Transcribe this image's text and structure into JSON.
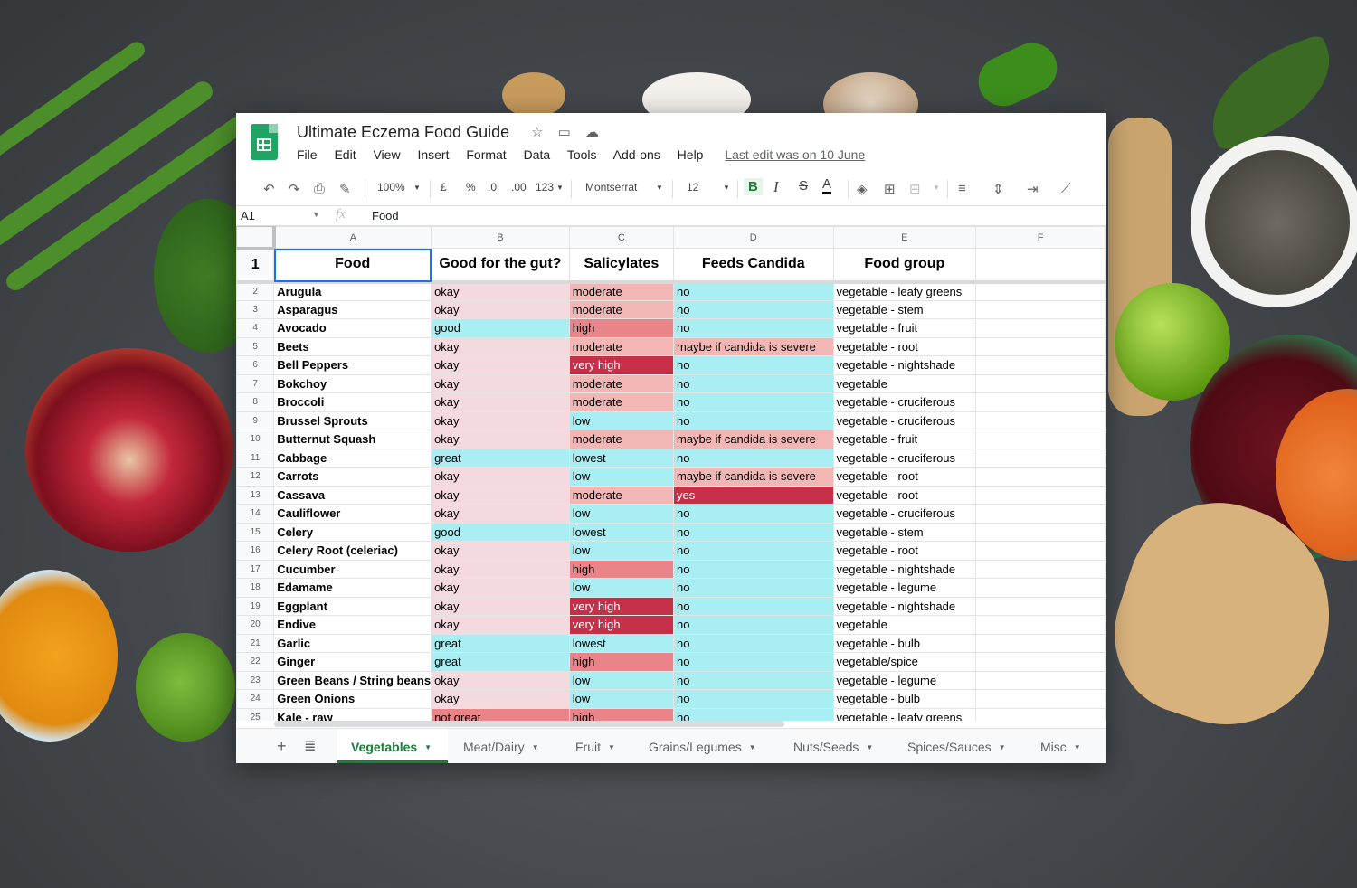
{
  "window": {
    "doc_title": "Ultimate Eczema Food Guide",
    "menu": [
      "File",
      "Edit",
      "View",
      "Insert",
      "Format",
      "Data",
      "Tools",
      "Add-ons",
      "Help"
    ],
    "last_edit": "Last edit was on 10 June"
  },
  "toolbar": {
    "zoom": "100%",
    "currency": "£",
    "percent": "%",
    "dec_less": ".0",
    "dec_more": ".00",
    "more_formats": "123",
    "font": "Montserrat",
    "font_size": "12",
    "bold": "B",
    "italic": "I",
    "strike": "S",
    "text_color": "A"
  },
  "formula_bar": {
    "cell_ref": "A1",
    "fx": "fx",
    "value": "Food"
  },
  "columns": [
    "A",
    "B",
    "C",
    "D",
    "E",
    "F"
  ],
  "header_row": {
    "number": "1",
    "cells": [
      "Food",
      "Good for the gut?",
      "Salicylates",
      "Feeds Candida",
      "Food group",
      ""
    ]
  },
  "colors": {
    "pink": "#f4d9de",
    "cyan": "#a9eef2",
    "moderate": "#f2b7b5",
    "high": "#ea8488",
    "very_high": "#c62f48",
    "yes": "#c62f48",
    "maybe": "#f2b7b5",
    "not_great": "#ea8488"
  },
  "rows": [
    {
      "n": "2",
      "food": "Arugula",
      "gut": "okay",
      "sal": "moderate",
      "candida": "no",
      "group": "vegetable - leafy greens"
    },
    {
      "n": "3",
      "food": "Asparagus",
      "gut": "okay",
      "sal": "moderate",
      "candida": "no",
      "group": "vegetable - stem"
    },
    {
      "n": "4",
      "food": "Avocado",
      "gut": "good",
      "sal": "high",
      "candida": "no",
      "group": "vegetable - fruit"
    },
    {
      "n": "5",
      "food": "Beets",
      "gut": "okay",
      "sal": "moderate",
      "candida": "maybe if candida is severe",
      "group": "vegetable - root"
    },
    {
      "n": "6",
      "food": "Bell Peppers",
      "gut": "okay",
      "sal": "very high",
      "candida": "no",
      "group": "vegetable - nightshade"
    },
    {
      "n": "7",
      "food": "Bokchoy",
      "gut": "okay",
      "sal": "moderate",
      "candida": "no",
      "group": "vegetable"
    },
    {
      "n": "8",
      "food": "Broccoli",
      "gut": "okay",
      "sal": "moderate",
      "candida": "no",
      "group": "vegetable - cruciferous"
    },
    {
      "n": "9",
      "food": "Brussel Sprouts",
      "gut": "okay",
      "sal": "low",
      "candida": "no",
      "group": "vegetable - cruciferous"
    },
    {
      "n": "10",
      "food": "Butternut Squash",
      "gut": "okay",
      "sal": "moderate",
      "candida": "maybe if candida is severe",
      "group": "vegetable - fruit"
    },
    {
      "n": "11",
      "food": "Cabbage",
      "gut": "great",
      "sal": "lowest",
      "candida": "no",
      "group": "vegetable - cruciferous"
    },
    {
      "n": "12",
      "food": "Carrots",
      "gut": "okay",
      "sal": "low",
      "candida": "maybe if candida is severe",
      "group": "vegetable - root"
    },
    {
      "n": "13",
      "food": "Cassava",
      "gut": "okay",
      "sal": "moderate",
      "candida": "yes",
      "group": "vegetable - root"
    },
    {
      "n": "14",
      "food": "Cauliflower",
      "gut": "okay",
      "sal": "low",
      "candida": "no",
      "group": "vegetable - cruciferous"
    },
    {
      "n": "15",
      "food": "Celery",
      "gut": "good",
      "sal": "lowest",
      "candida": "no",
      "group": "vegetable - stem"
    },
    {
      "n": "16",
      "food": "Celery Root (celeriac)",
      "gut": "okay",
      "sal": "low",
      "candida": "no",
      "group": "vegetable - root"
    },
    {
      "n": "17",
      "food": "Cucumber",
      "gut": "okay",
      "sal": "high",
      "candida": "no",
      "group": "vegetable - nightshade"
    },
    {
      "n": "18",
      "food": "Edamame",
      "gut": "okay",
      "sal": "low",
      "candida": "no",
      "group": "vegetable - legume"
    },
    {
      "n": "19",
      "food": "Eggplant",
      "gut": "okay",
      "sal": "very high",
      "candida": "no",
      "group": "vegetable - nightshade"
    },
    {
      "n": "20",
      "food": "Endive",
      "gut": "okay",
      "sal": "very high",
      "candida": "no",
      "group": "vegetable"
    },
    {
      "n": "21",
      "food": "Garlic",
      "gut": "great",
      "sal": "lowest",
      "candida": "no",
      "group": "vegetable - bulb"
    },
    {
      "n": "22",
      "food": "Ginger",
      "gut": "great",
      "sal": "high",
      "candida": "no",
      "group": "vegetable/spice"
    },
    {
      "n": "23",
      "food": "Green Beans / String beans",
      "gut": "okay",
      "sal": "low",
      "candida": "no",
      "group": "vegetable - legume"
    },
    {
      "n": "24",
      "food": "Green Onions",
      "gut": "okay",
      "sal": "low",
      "candida": "no",
      "group": "vegetable - bulb"
    },
    {
      "n": "25",
      "food": "Kale - raw",
      "gut": "not great",
      "sal": "high",
      "candida": "no",
      "group": "vegetable - leafy greens"
    }
  ],
  "tabs": [
    "Vegetables",
    "Meat/Dairy",
    "Fruit",
    "Grains/Legumes",
    "Nuts/Seeds",
    "Spices/Sauces",
    "Misc"
  ]
}
